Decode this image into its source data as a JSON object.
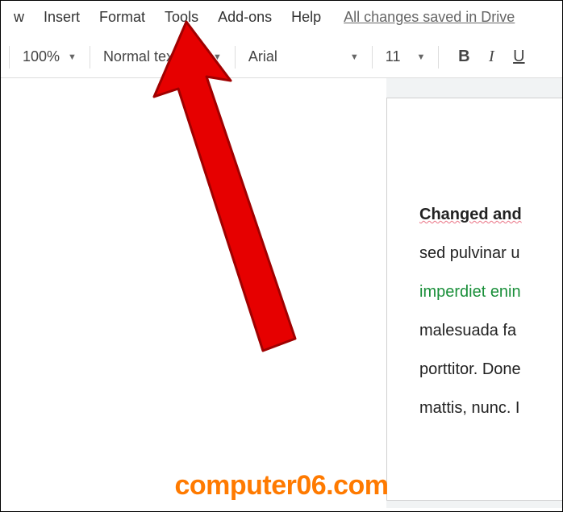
{
  "menubar": {
    "items": [
      "w",
      "Insert",
      "Format",
      "Tools",
      "Add-ons",
      "Help"
    ],
    "save_status": "All changes saved in Drive"
  },
  "toolbar": {
    "zoom": "100%",
    "paragraph_style": "Normal text",
    "font": "Arial",
    "font_size": "11",
    "bold_label": "B",
    "italic_label": "I",
    "underline_label": "U"
  },
  "document": {
    "lines": [
      {
        "text": "Changed and",
        "class": "heading"
      },
      {
        "text": "sed pulvinar u",
        "class": ""
      },
      {
        "text": "imperdiet enin",
        "class": "green-text"
      },
      {
        "text": "malesuada fa",
        "class": ""
      },
      {
        "text": "porttitor. Done",
        "class": ""
      },
      {
        "text": "mattis, nunc. I",
        "class": ""
      }
    ]
  },
  "watermark": "computer06.com",
  "annotation": {
    "arrow_points_to": "Tools menu",
    "arrow_color": "#e60000"
  }
}
